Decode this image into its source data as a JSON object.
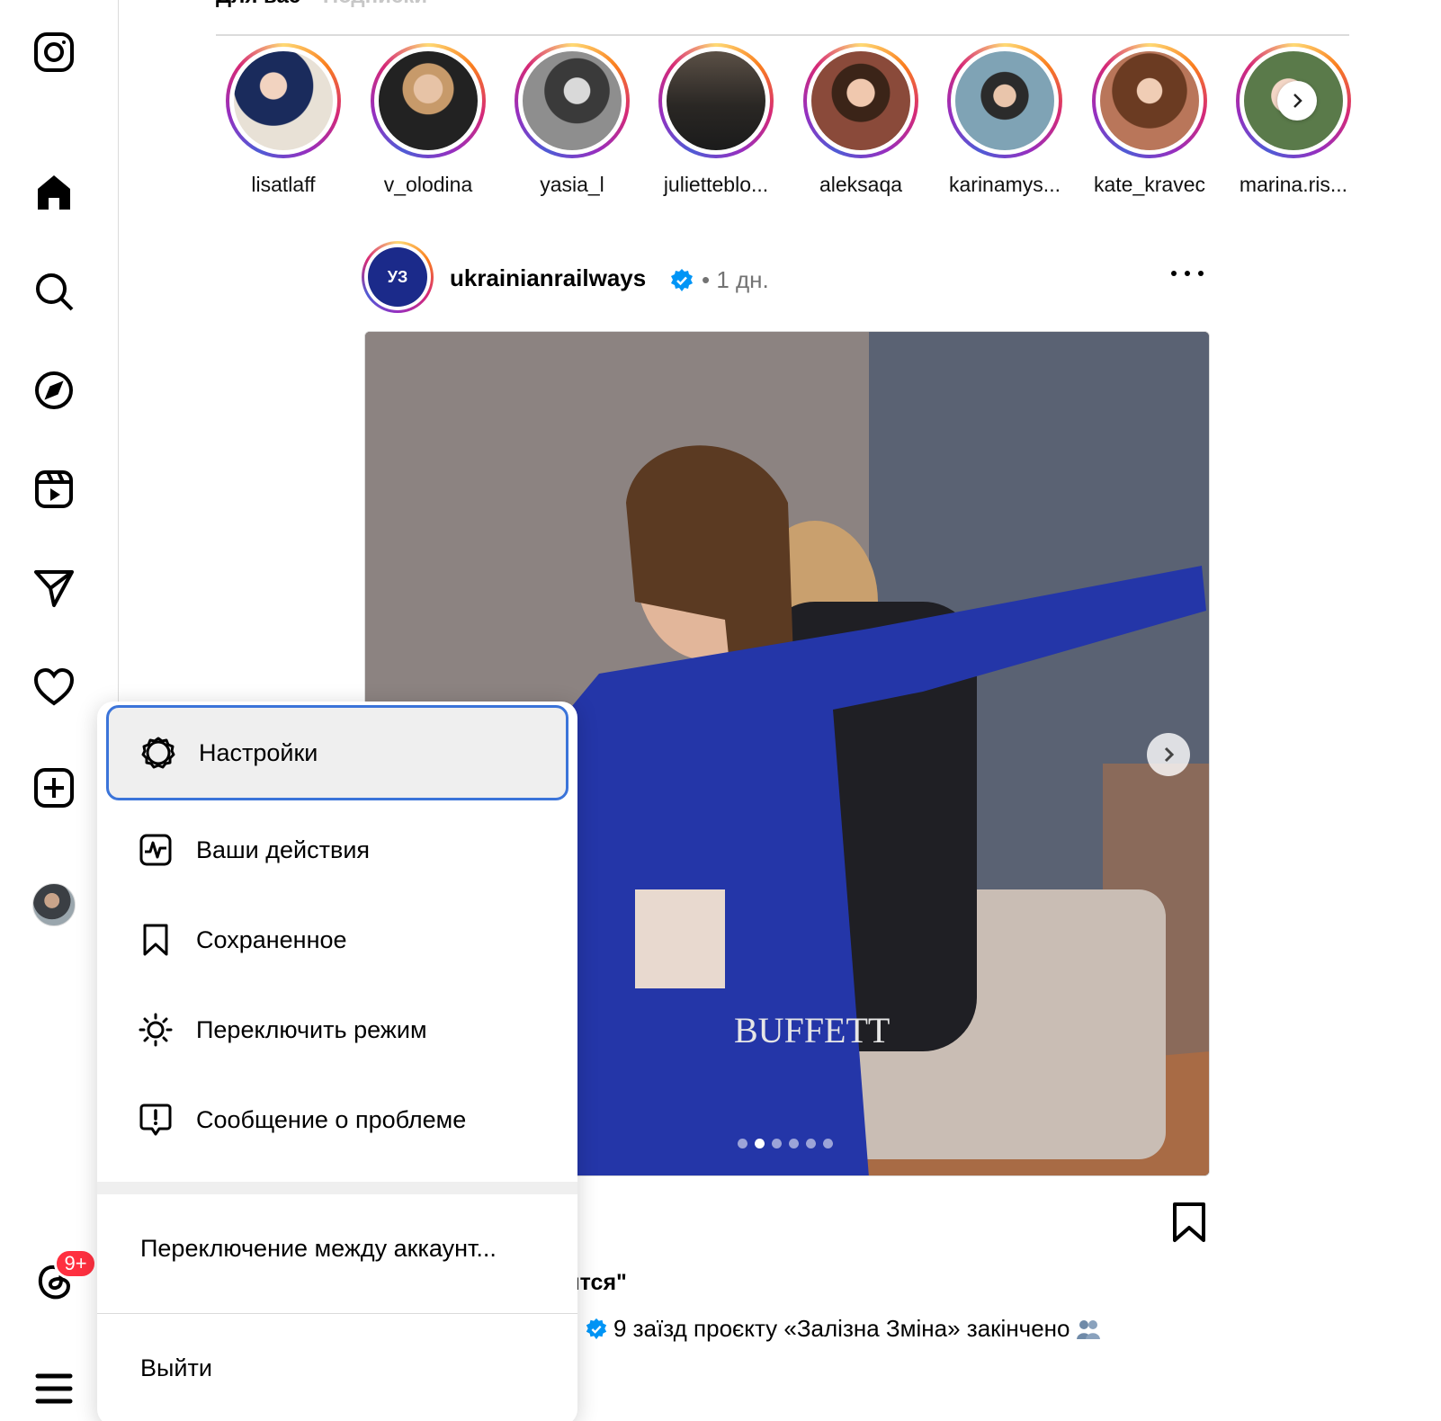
{
  "feed_tabs": {
    "for_you": "Для вас",
    "following": "Подписки"
  },
  "stories": [
    {
      "name": "lisatlaff"
    },
    {
      "name": "v_olodina"
    },
    {
      "name": "yasia_l"
    },
    {
      "name": "julietteblo..."
    },
    {
      "name": "aleksaqa"
    },
    {
      "name": "karinamys..."
    },
    {
      "name": "kate_kravec"
    },
    {
      "name": "marina.ris..."
    }
  ],
  "post": {
    "username": "ukrainianrailways",
    "avatar_text": "УЗ",
    "time": "• 1 дн.",
    "likes_fragment": "авится\"",
    "caption": "9 заїзд проєкту «Залізна Зміна» закінчено"
  },
  "notifications_badge": "9+",
  "menu": {
    "settings": "Настройки",
    "activity": "Ваши действия",
    "saved": "Сохраненное",
    "switch_mode": "Переключить режим",
    "report_problem": "Сообщение о проблеме",
    "switch_accounts": "Переключение между аккаунт...",
    "logout": "Выйти"
  },
  "colors": {
    "accent_blue": "#3b74d9",
    "badge_red": "#ff3040",
    "verified_blue": "#0095f6"
  }
}
